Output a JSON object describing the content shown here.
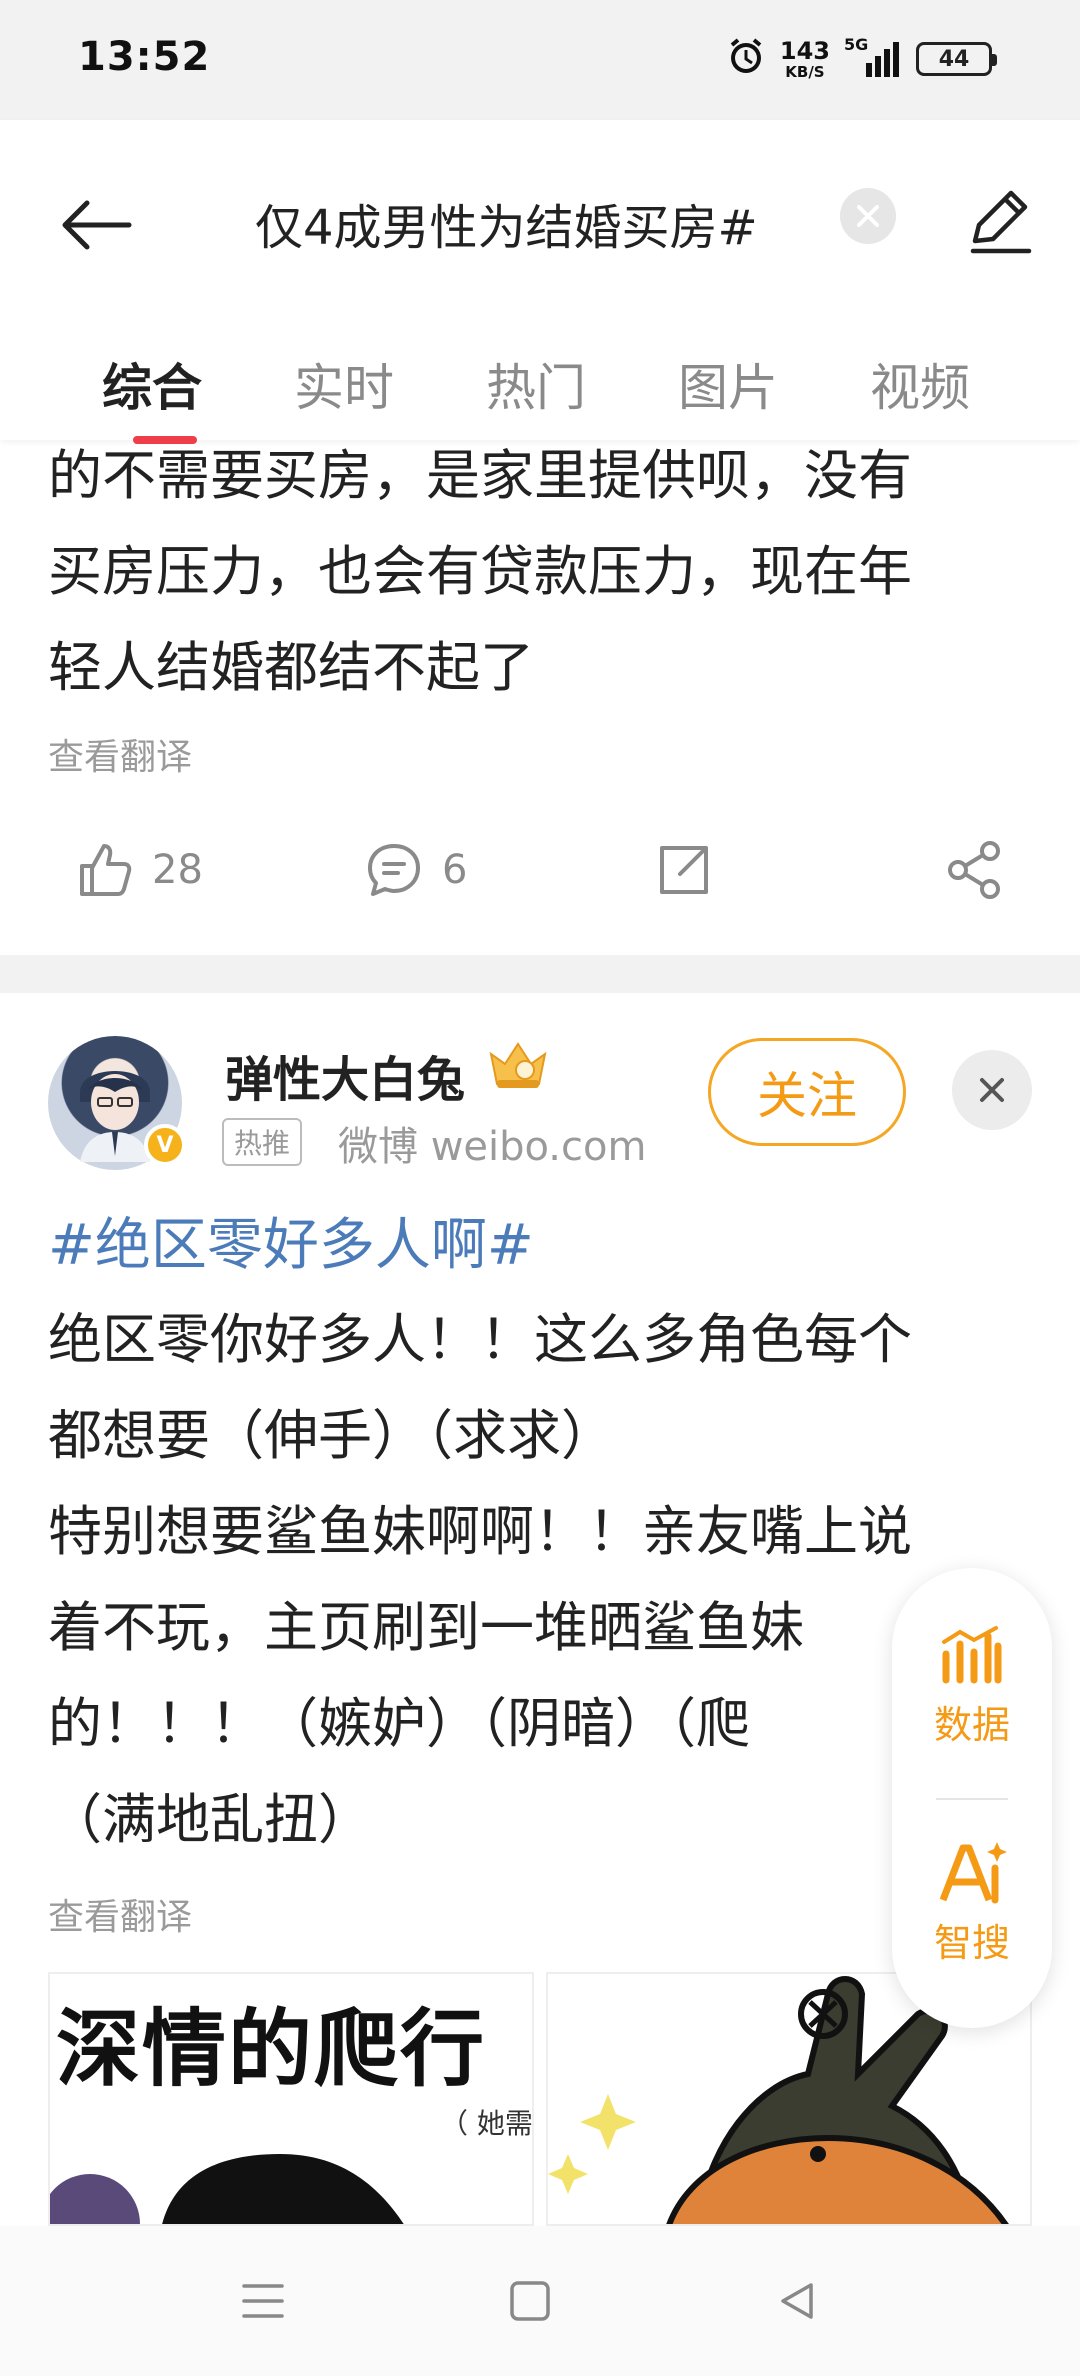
{
  "status_bar": {
    "time": "13:52",
    "net_speed_value": "143",
    "net_speed_unit": "KB/S",
    "network": "5G",
    "battery": "44",
    "icons": [
      "alarm-icon",
      "signal-icon",
      "battery-icon"
    ]
  },
  "header": {
    "search_query": "仅4成男性为结婚买房#",
    "tabs": [
      {
        "label": "综合",
        "active": true
      },
      {
        "label": "实时",
        "active": false
      },
      {
        "label": "热门",
        "active": false
      },
      {
        "label": "图片",
        "active": false
      },
      {
        "label": "视频",
        "active": false
      }
    ],
    "accent_color": "#ef3e4a"
  },
  "post1": {
    "text_lines": [
      "的不需要买房，是家里提供呗，没有",
      "买房压力，也会有贷款压力，现在年",
      "轻人结婚都结不起了"
    ],
    "translate_label": "查看翻译",
    "likes": "28",
    "comments": "6"
  },
  "post2": {
    "username": "弹性大白兔",
    "hot_tag": "热推",
    "source": "微博  weibo.com",
    "follow_label": "关注",
    "hashtag": "#绝区零好多人啊#",
    "text_lines": [
      "绝区零你好多人！！这么多角色每个",
      "都想要（伸手）（求求）",
      "特别想要鲨鱼妹啊啊！！亲友嘴上说",
      "着不玩，主页刷到一堆晒鲨鱼妹",
      "的！！！（嫉妒）（阴暗）（爬",
      "（满地乱扭）"
    ],
    "translate_label": "查看翻译",
    "image1_caption": "深情的爬行",
    "image1_small": "（ 她需云"
  },
  "side_panel": {
    "items": [
      {
        "label": "数据",
        "icon": "data-chart-icon"
      },
      {
        "label": "智搜",
        "icon": "ai-search-icon"
      }
    ],
    "color": "#f59a14"
  }
}
